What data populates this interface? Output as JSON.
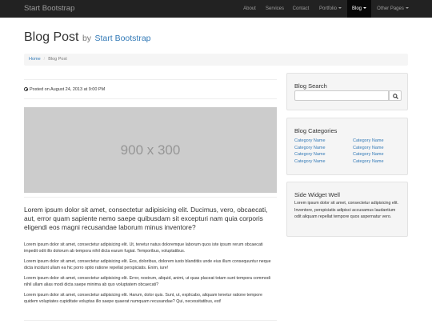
{
  "navbar": {
    "brand": "Start Bootstrap",
    "items": [
      {
        "label": "About"
      },
      {
        "label": "Services"
      },
      {
        "label": "Contact"
      },
      {
        "label": "Portfolio"
      },
      {
        "label": "Blog"
      },
      {
        "label": "Other Pages"
      }
    ]
  },
  "header": {
    "title": "Blog Post",
    "by": "by",
    "subtitle": "Start Bootstrap"
  },
  "breadcrumb": {
    "home": "Home",
    "separator": "/",
    "current": "Blog Post"
  },
  "post": {
    "posted": "Posted on August 24, 2013 at 9:00 PM",
    "image_placeholder": "900 x 300",
    "lead": "Lorem ipsum dolor sit amet, consectetur adipisicing elit. Ducimus, vero, obcaecati, aut, error quam sapiente nemo saepe quibusdam sit excepturi nam quia corporis eligendi eos magni recusandae laborum minus inventore?",
    "paragraphs": [
      "Lorem ipsum dolor sit amet, consectetur adipisicing elit. Ut, tenetur natus doloremque laborum quos iste ipsum rerum obcaecati impedit odit illo dolorum ab tempora nihil dicta earum fugiat. Temporibus, voluptatibus.",
      "Lorem ipsum dolor sit amet, consectetur adipisicing elit. Eos, doloribus, dolorem iusto blanditiis unde eius illum consequuntur neque dicta incidunt ullam ea hic porro optio ratione repellat perspiciatis. Enim, iure!",
      "Lorem ipsum dolor sit amet, consectetur adipisicing elit. Error, nostrum, aliquid, animi, ut quas placeat totam sunt tempora commodi nihil ullam alias modi dicta saepe minima ab quo voluptatem obcaecati?",
      "Lorem ipsum dolor sit amet, consectetur adipisicing elit. Harum, dolor quis. Sunt, ut, explicabo, aliquam tenetur ratione tempore quidem voluptates cupiditate voluptas illo saepe quaerat numquam recusandae? Qui, necessitatibus, est!"
    ]
  },
  "sidebar": {
    "search": {
      "title": "Blog Search",
      "placeholder": "",
      "button_icon": "search-icon"
    },
    "categories": {
      "title": "Blog Categories",
      "left": [
        "Category Name",
        "Category Name",
        "Category Name",
        "Category Name"
      ],
      "right": [
        "Category Name",
        "Category Name",
        "Category Name",
        "Category Name"
      ]
    },
    "widget": {
      "title": "Side Widget Well",
      "text": "Lorem ipsum dolor sit amet, consectetur adipisicing elit. Inventore, perspiciatis adipisci accusamus laudantium odit aliquam repellat tempore quos aspernatur vero."
    }
  },
  "colors": {
    "navbar_bg": "#222222",
    "navbar_active": "#080808",
    "link": "#337ab7",
    "placeholder_bg": "#cccccc",
    "well_bg": "#f5f5f5"
  }
}
